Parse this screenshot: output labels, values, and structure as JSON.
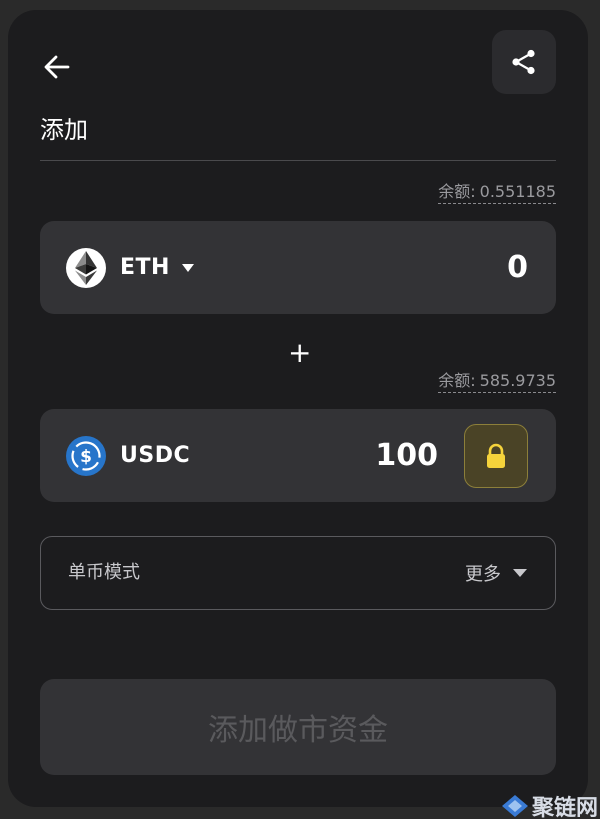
{
  "header": {
    "back_icon": "arrow-left-icon",
    "share_icon": "share-icon",
    "title": "添加"
  },
  "token_a": {
    "balance_label": "余额:",
    "balance_value": "0.551185",
    "symbol": "ETH",
    "icon": "ethereum-icon",
    "amount": "0"
  },
  "plus_sign": "+",
  "token_b": {
    "balance_label": "余额:",
    "balance_value": "585.9735",
    "symbol": "USDC",
    "icon": "usdc-icon",
    "amount": "100",
    "lock_icon": "lock-icon"
  },
  "mode": {
    "label": "单币模式",
    "more_label": "更多"
  },
  "submit": {
    "label": "添加做市资金"
  },
  "watermark": {
    "text": "聚链网"
  },
  "colors": {
    "card_bg": "#1c1c1e",
    "field_bg": "#333336",
    "usdc_blue": "#2775ca",
    "lock_yellow": "#f5d33b"
  }
}
